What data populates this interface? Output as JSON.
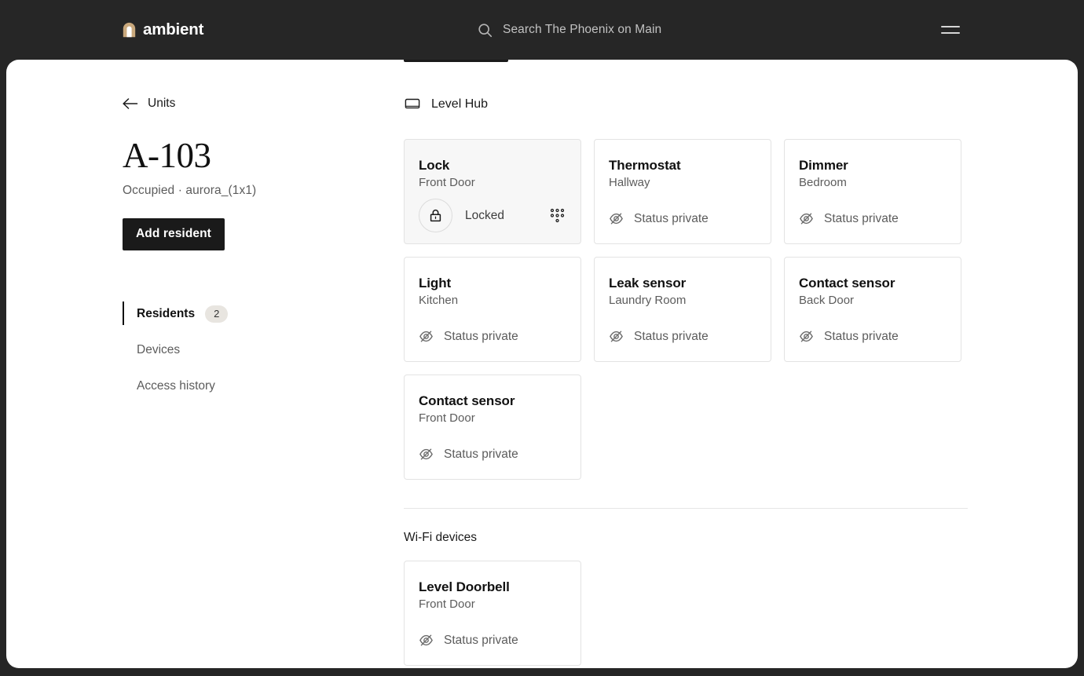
{
  "topbar": {
    "brand_name": "ambient",
    "brand_mark_icon": "arch-logo-icon",
    "brand_color": "#c9a87c",
    "search": {
      "icon": "search-icon",
      "placeholder": "Search The Phoenix on Main",
      "value": ""
    },
    "menu_icon": "hamburger-menu-icon",
    "background_color": "#262626"
  },
  "left": {
    "back": {
      "icon": "arrow-left-icon",
      "label": "Units"
    },
    "unit_title": "A-103",
    "unit_subtitle": "Occupied · aurora_(1x1)",
    "add_resident_label": "Add resident",
    "nav": [
      {
        "label": "Residents",
        "badge": "2",
        "active": true
      },
      {
        "label": "Devices",
        "badge": "",
        "active": false
      },
      {
        "label": "Access history",
        "badge": "",
        "active": false
      }
    ]
  },
  "main": {
    "hub_section": {
      "icon": "hub-device-icon",
      "label": "Level Hub",
      "cards": [
        {
          "title": "Lock",
          "location": "Front Door",
          "kind": "lock",
          "lock_icon": "padlock-closed-icon",
          "lock_state": "Locked",
          "keypad_icon": "keypad-dots-icon",
          "tinted": true
        },
        {
          "title": "Thermostat",
          "location": "Hallway",
          "kind": "status",
          "status_icon": "eye-off-icon",
          "status": "Status private",
          "tinted": false
        },
        {
          "title": "Dimmer",
          "location": "Bedroom",
          "kind": "status",
          "status_icon": "eye-off-icon",
          "status": "Status private",
          "tinted": false
        },
        {
          "title": "Light",
          "location": "Kitchen",
          "kind": "status",
          "status_icon": "eye-off-icon",
          "status": "Status private",
          "tinted": false
        },
        {
          "title": "Leak sensor",
          "location": "Laundry Room",
          "kind": "status",
          "status_icon": "eye-off-icon",
          "status": "Status private",
          "tinted": false
        },
        {
          "title": "Contact sensor",
          "location": "Back Door",
          "kind": "status",
          "status_icon": "eye-off-icon",
          "status": "Status private",
          "tinted": false
        },
        {
          "title": "Contact sensor",
          "location": "Front Door",
          "kind": "status",
          "status_icon": "eye-off-icon",
          "status": "Status private",
          "tinted": false
        }
      ]
    },
    "wifi_section": {
      "label": "Wi-Fi devices",
      "cards": [
        {
          "title": "Level Doorbell",
          "location": "Front Door",
          "kind": "status",
          "status_icon": "eye-off-icon",
          "status": "Status private",
          "tinted": false
        }
      ]
    }
  }
}
